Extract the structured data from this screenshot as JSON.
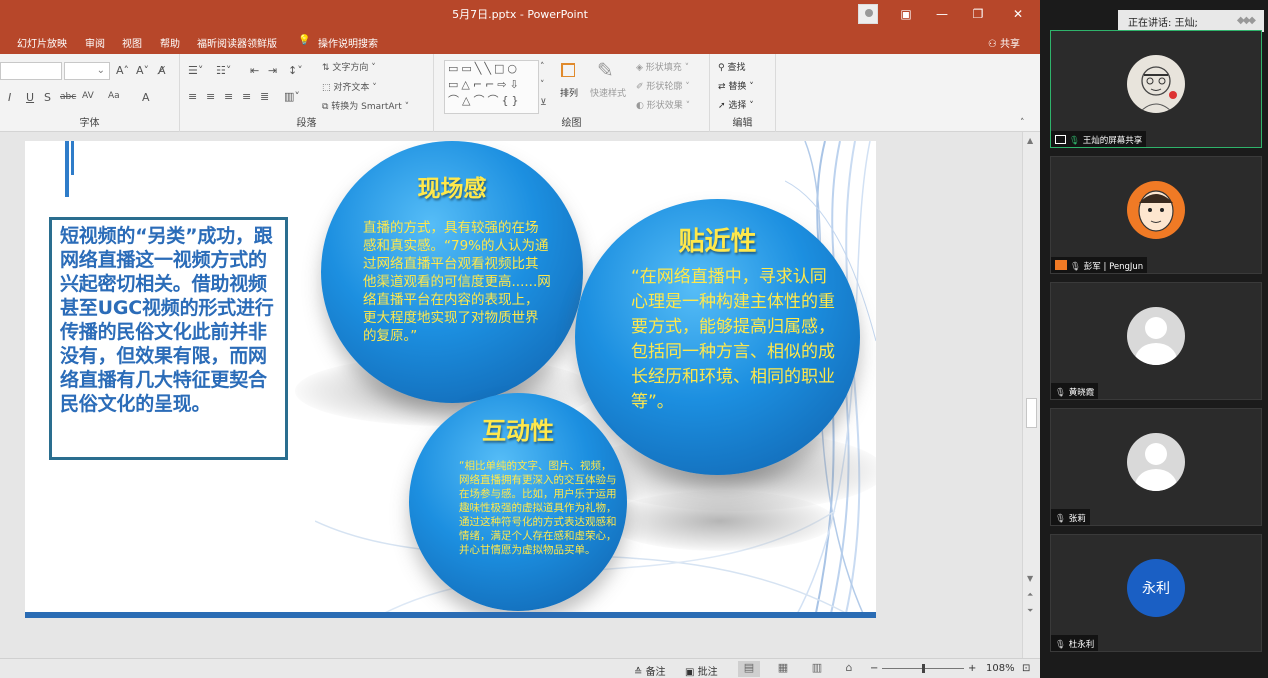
{
  "window": {
    "title": "5月7日.pptx - PowerPoint",
    "controls": [
      "restore-icon",
      "minimize-icon",
      "maximize-icon",
      "close-icon"
    ]
  },
  "menubar": {
    "items": [
      "幻灯片放映",
      "审阅",
      "视图",
      "帮助",
      "福昕阅读器领鲜版"
    ],
    "search_label": "操作说明搜索",
    "share_label": "共享"
  },
  "ribbon": {
    "groups": {
      "font": "字体",
      "paragraph": "段落",
      "drawing": "绘图",
      "editing": "编辑"
    },
    "font_buttons": [
      "I",
      "U",
      "S",
      "abc",
      "AV",
      "Aa",
      "A"
    ],
    "text_direction": "文字方向",
    "align_text": "对齐文本",
    "smartart": "转换为 SmartArt",
    "arrange": "排列",
    "quick_styles": "快速样式",
    "shape_fill": "形状填充",
    "shape_outline": "形状轮廓",
    "shape_effects": "形状效果",
    "find": "查找",
    "replace": "替换",
    "select": "选择"
  },
  "slide": {
    "left_text": "短视频的“另类”成功，跟网络直播这一视频方式的兴起密切相关。借助视频甚至UGC视频的形式进行传播的民俗文化此前并非没有，但效果有限，而网络直播有几大特征更契合民俗文化的呈现。",
    "circle1": {
      "title": "现场感",
      "body": "直播的方式，具有较强的在场感和真实感。“79%的人认为通过网络直播平台观看视频比其他渠道观看的可信度更高......网络直播平台在内容的表现上，更大程度地实现了对物质世界的复原。”"
    },
    "circle2": {
      "title": "贴近性",
      "body": "“在网络直播中，寻求认同心理是一种构建主体性的重要方式，能够提高归属感，包括同一种方言、相似的成长经历和环境、相同的职业等”。"
    },
    "circle3": {
      "title": "互动性",
      "body": "“相比单纯的文字、图片、视频，网络直播拥有更深入的交互体验与在场参与感。比如，用户乐于运用趣味性极强的虚拟道具作为礼物，通过这种符号化的方式表达观感和情绪，满足个人存在感和虚荣心，并心甘情愿为虚拟物品买单。"
    }
  },
  "statusbar": {
    "notes": "备注",
    "comments": "批注",
    "zoom": "108%"
  },
  "meeting": {
    "now_speaking": "正在讲话: 王灿;",
    "participants": [
      {
        "name": "王灿的屏幕共享",
        "avatar": "sketch-portrait"
      },
      {
        "name": "彭军 | PengJun",
        "avatar": "cartoon-portrait"
      },
      {
        "name": "黄晓霞",
        "avatar": "default"
      },
      {
        "name": "张莉",
        "avatar": "default"
      },
      {
        "name": "杜永利",
        "avatar_text": "永利"
      }
    ]
  }
}
